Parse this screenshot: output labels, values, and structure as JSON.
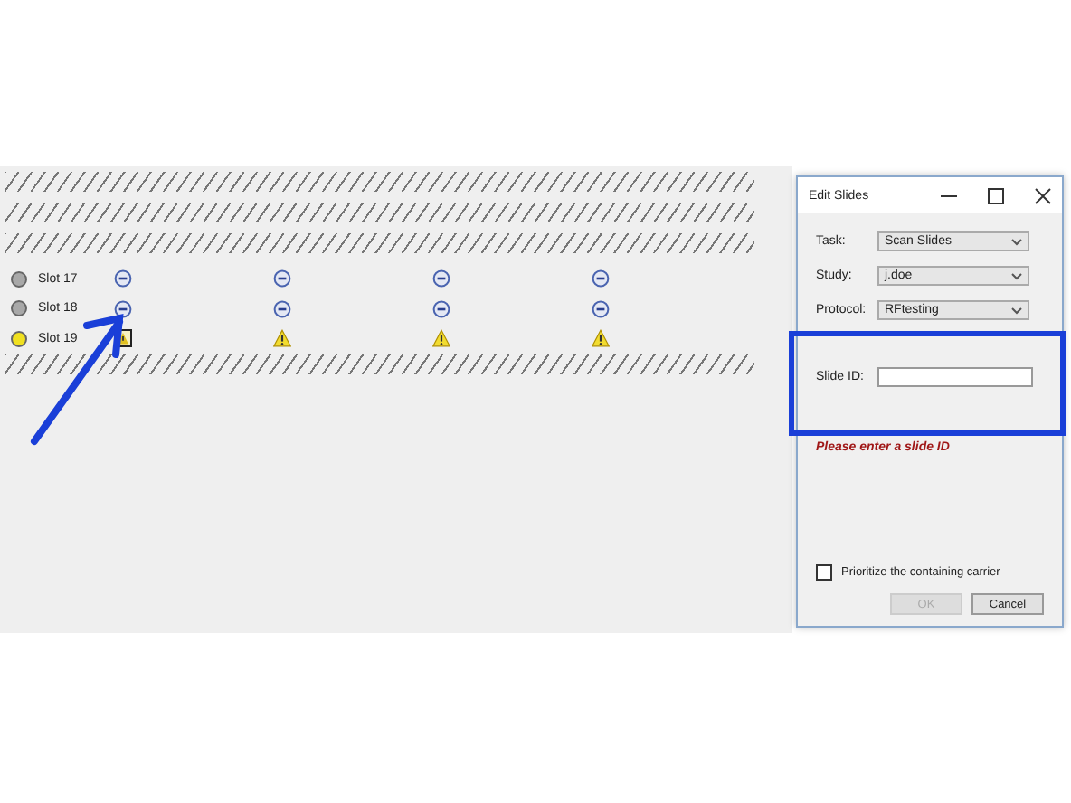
{
  "slots": [
    {
      "label": "Slot 17",
      "color": "#a8a8a8",
      "cells": [
        {
          "kind": "blocked"
        },
        {
          "kind": "blocked"
        },
        {
          "kind": "blocked"
        },
        {
          "kind": "blocked"
        }
      ]
    },
    {
      "label": "Slot 18",
      "color": "#a8a8a8",
      "cells": [
        {
          "kind": "blocked"
        },
        {
          "kind": "blocked"
        },
        {
          "kind": "blocked"
        },
        {
          "kind": "blocked"
        }
      ]
    },
    {
      "label": "Slot 19",
      "color": "#f0e020",
      "cells": [
        {
          "kind": "alert"
        },
        {
          "kind": "warning"
        },
        {
          "kind": "warning"
        },
        {
          "kind": "warning"
        }
      ]
    }
  ],
  "dialog": {
    "title": "Edit Slides",
    "fields": [
      {
        "kind": "dropdown",
        "label": "Task:",
        "value": "Scan Slides"
      },
      {
        "kind": "dropdown",
        "label": "Study:",
        "value": "j.doe"
      },
      {
        "kind": "dropdown",
        "label": "Protocol:",
        "value": "RFtesting"
      },
      {
        "kind": "text",
        "label": "Slide ID:"
      }
    ],
    "message": "Please enter a slide ID",
    "checkbox": {
      "label": "Prioritize the containing carrier",
      "checked": false
    },
    "buttons": [
      {
        "label": "OK",
        "disabled": true
      },
      {
        "label": "Cancel",
        "disabled": false
      }
    ]
  }
}
